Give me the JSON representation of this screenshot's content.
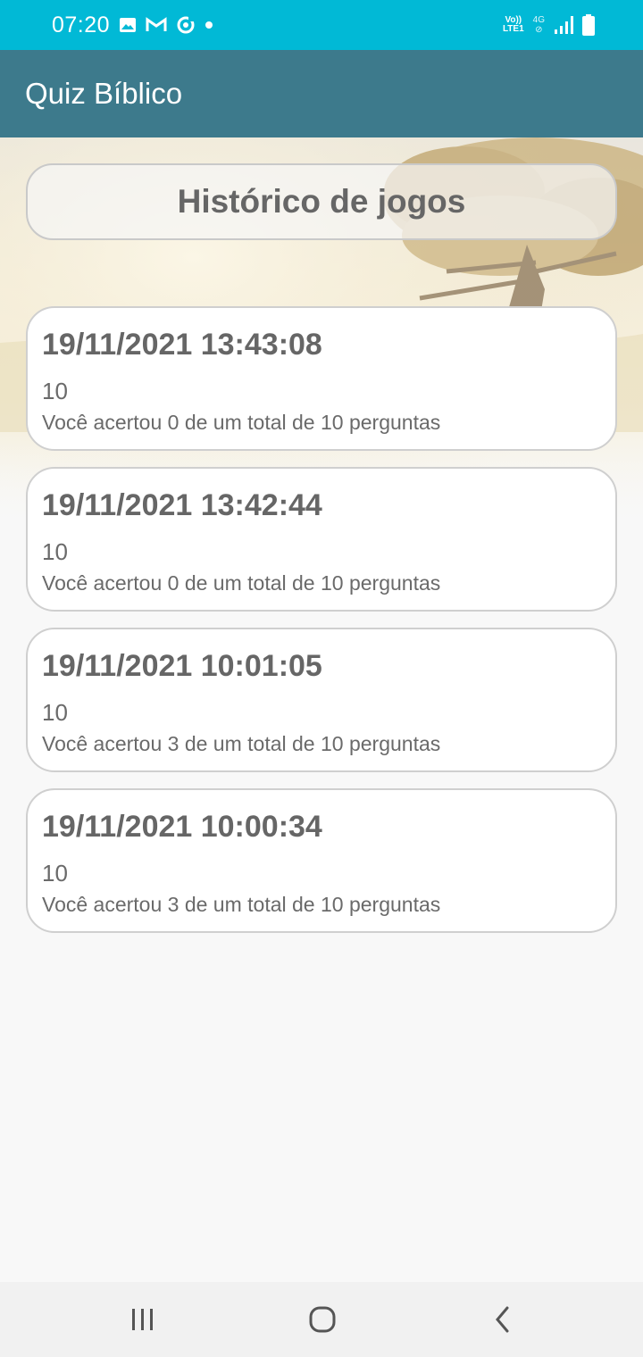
{
  "status_bar": {
    "time": "07:20",
    "left_icons": [
      "gallery-icon",
      "gmail-icon",
      "sync-icon",
      "dot-icon"
    ],
    "volte_top": "Vo))",
    "volte_bottom": "LTE1",
    "net_type": "4G",
    "right_icons": [
      "signal-icon",
      "battery-icon"
    ]
  },
  "app_bar": {
    "title": "Quiz Bíblico"
  },
  "header": {
    "title": "Histórico de jogos"
  },
  "games": [
    {
      "date": "19/11/2021 13:43:08",
      "score": "10",
      "summary": "Você acertou 0 de um total de 10 perguntas"
    },
    {
      "date": "19/11/2021 13:42:44",
      "score": "10",
      "summary": "Você acertou 0 de um total de 10 perguntas"
    },
    {
      "date": "19/11/2021 10:01:05",
      "score": "10",
      "summary": "Você acertou 3 de um total de 10 perguntas"
    },
    {
      "date": "19/11/2021 10:00:34",
      "score": "10",
      "summary": "Você acertou 3 de um total de 10 perguntas"
    }
  ],
  "nav_bar": {
    "buttons": [
      "recent-apps-icon",
      "home-icon",
      "back-icon"
    ]
  },
  "colors": {
    "status_bar": "#01b9d6",
    "app_bar": "#3d7a8c",
    "text_gray": "#666666"
  }
}
